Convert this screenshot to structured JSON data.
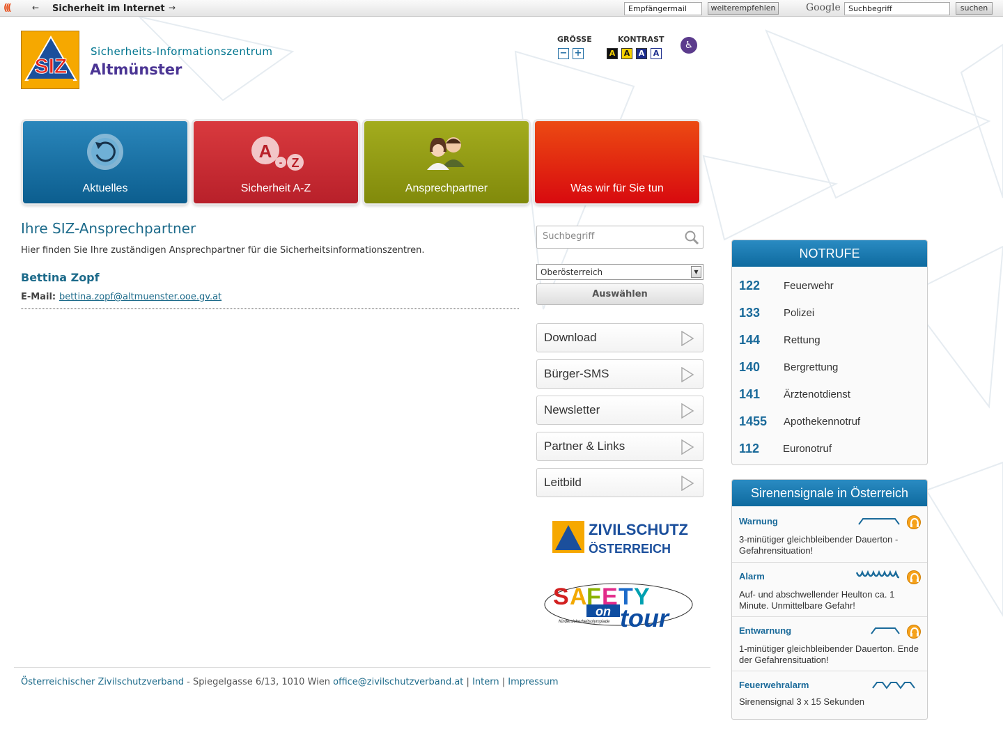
{
  "toolbar": {
    "title": "Sicherheit im Internet",
    "recipient_value": "Empfängermail",
    "recommend_label": "weiterempfehlen",
    "google_label": "Google",
    "search_value": "Suchbegriff",
    "search_label": "suchen"
  },
  "header": {
    "logo_text": "SIZ",
    "org_subtitle": "Sicherheits-Informationszentrum",
    "org_name": "Altmünster",
    "size_label": "GRÖSSE",
    "contrast_label": "KONTRAST",
    "size_minus": "−",
    "size_plus": "+",
    "contrast_a": "A"
  },
  "tiles": [
    {
      "label": "Aktuelles",
      "icon": "refresh-icon",
      "color": "#0f6ea3"
    },
    {
      "label": "Sicherheit A-Z",
      "icon": "a-z-icon",
      "color": "#c9262c"
    },
    {
      "label": "Ansprechpartner",
      "icon": "people-icon",
      "color": "#8e9612"
    },
    {
      "label": "Was wir für Sie tun",
      "icon": "",
      "color": "#e0100e"
    }
  ],
  "main": {
    "title": "Ihre SIZ-Ansprechpartner",
    "intro": "Hier finden Sie Ihre zuständigen Ansprechpartner für die Sicherheitsinformationszentren.",
    "person_name": "Bettina Zopf",
    "email_label": "E-Mail:",
    "email": "bettina.zopf@altmuenster.ooe.gv.at"
  },
  "sidebar": {
    "search_placeholder": "Suchbegriff",
    "region_selected": "Oberösterreich",
    "choose_label": "Auswählen",
    "links": [
      "Download",
      "Bürger-SMS",
      "Newsletter",
      "Partner & Links",
      "Leitbild"
    ],
    "zivilschutz_line1": "ZIVILSCHUTZ",
    "zivilschutz_line2": "ÖSTERREICH",
    "safety_logo": "SAFETY on tour",
    "safety_sub": "Kindersicherheitsolympiade"
  },
  "notrufe": {
    "title": "NOTRUFE",
    "rows": [
      {
        "num": "122",
        "label": "Feuerwehr"
      },
      {
        "num": "133",
        "label": "Polizei"
      },
      {
        "num": "144",
        "label": "Rettung"
      },
      {
        "num": "140",
        "label": "Bergrettung"
      },
      {
        "num": "141",
        "label": "Ärztenotdienst"
      },
      {
        "num": "1455",
        "label": "Apothekennotruf"
      },
      {
        "num": "112",
        "label": "Euronotruf"
      }
    ]
  },
  "sirens": {
    "title": "Sirenensignale in Österreich",
    "items": [
      {
        "name": "Warnung",
        "desc": "3-minütiger gleichbleibender Dauerton - Gefahrensituation!"
      },
      {
        "name": "Alarm",
        "desc": "Auf- und abschwellender Heulton ca. 1 Minute. Unmittelbare Gefahr!"
      },
      {
        "name": "Entwarnung",
        "desc": "1-minütiger gleichbleibender Dauerton. Ende der Gefahrensituation!"
      },
      {
        "name": "Feuerwehralarm",
        "desc": "Sirenensignal 3 x 15 Sekunden"
      }
    ]
  },
  "footer": {
    "org": "Österreichischer Zivilschutzverband",
    "dash": " - ",
    "address": "Spiegelgasse 6/13, 1010 Wien",
    "email": "office@zivilschutzverband.at",
    "sep": "|",
    "intern": "Intern",
    "impressum": "Impressum"
  }
}
